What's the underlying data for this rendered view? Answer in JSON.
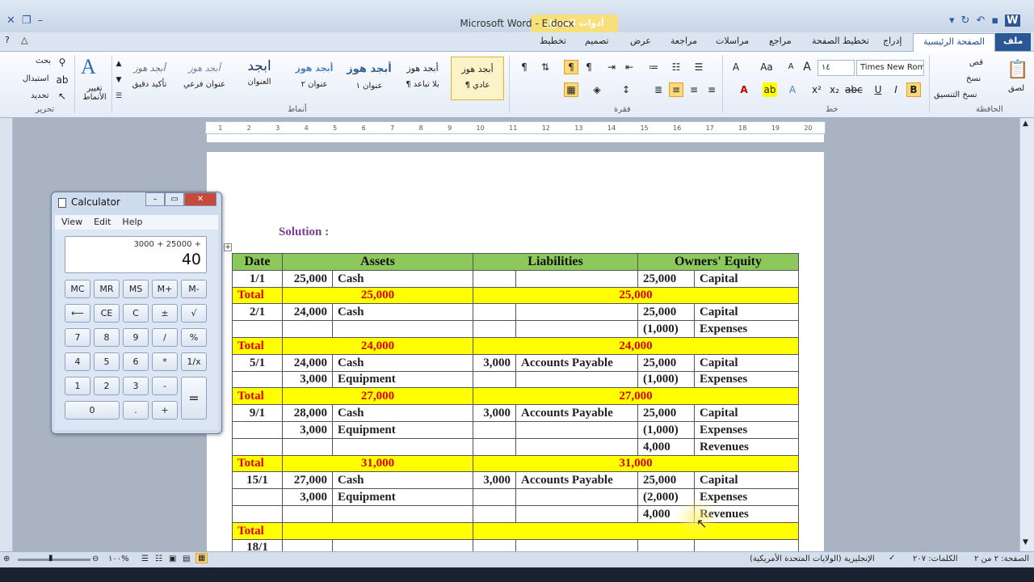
{
  "window": {
    "title": "Microsoft Word  -  E.docx",
    "context_tab": "أدوات الجدول"
  },
  "tabs": {
    "file": "ملف",
    "home": "الصفحة الرئيسية",
    "insert": "إدراج",
    "layout": "تخطيط الصفحة",
    "references": "مراجع",
    "mailings": "مراسلات",
    "review": "مراجعة",
    "view": "عرض",
    "design": "تصميم",
    "table_layout": "تخطيط"
  },
  "ribbon": {
    "clipboard": {
      "label": "الحافظة",
      "paste": "لصق",
      "cut": "قص",
      "copy": "نسخ",
      "format_painter": "نسخ التنسيق"
    },
    "font": {
      "label": "خط",
      "name": "Times New Roma",
      "size": "١٤"
    },
    "paragraph": {
      "label": "فقرة"
    },
    "styles": {
      "label": "أنماط",
      "items": [
        {
          "sample": "أبجد هوز",
          "name": "¶ عادي"
        },
        {
          "sample": "أبجد هوز",
          "name": "¶ بلا تباعد"
        },
        {
          "sample": "أبجد هوز",
          "name": "عنوان ١"
        },
        {
          "sample": "أبجد هوز",
          "name": "عنوان ٢"
        },
        {
          "sample": "ابجد",
          "name": "العنوان"
        },
        {
          "sample": "أبجد هوز",
          "name": "عنوان فرعي"
        },
        {
          "sample": "أبجد هوز",
          "name": "تأكيد دقيق"
        }
      ],
      "change_styles": "تغيير الأنماط"
    },
    "editing": {
      "label": "تحرير",
      "find": "بحث",
      "replace": "استبدال",
      "select": "تحديد"
    }
  },
  "ruler": {
    "ticks": [
      "1",
      "2",
      "3",
      "4",
      "5",
      "6",
      "7",
      "8",
      "9",
      "10",
      "11",
      "12",
      "13",
      "14",
      "15",
      "16",
      "17",
      "18",
      "19",
      "20"
    ]
  },
  "document": {
    "heading": "Solution :",
    "table": {
      "headers": {
        "date": "Date",
        "assets": "Assets",
        "liabilities": "Liabilities",
        "equity": "Owners'  Equity"
      },
      "r1": {
        "date": "1/1",
        "a_amt": "25,000",
        "a_name": "Cash",
        "e_amt": "25,000",
        "e_name": "Capital"
      },
      "t1": {
        "label": "Total",
        "assets": "25,000",
        "equity": "25,000"
      },
      "r2": {
        "date": "2/1",
        "a_amt": "24,000",
        "a_name": "Cash",
        "e_amt": "25,000",
        "e_name": "Capital"
      },
      "r3": {
        "e_amt": "(1,000)",
        "e_name": "Expenses"
      },
      "t2": {
        "label": "Total",
        "assets": "24,000",
        "equity": "24,000"
      },
      "r4": {
        "date": "5/1",
        "a_amt": "24,000",
        "a_name": "Cash",
        "l_amt": "3,000",
        "l_name": "Accounts Payable",
        "e_amt": "25,000",
        "e_name": "Capital"
      },
      "r5": {
        "a_amt": "3,000",
        "a_name": "Equipment",
        "e_amt": "(1,000)",
        "e_name": "Expenses"
      },
      "t3": {
        "label": "Total",
        "assets": "27,000",
        "equity": "27,000"
      },
      "r6": {
        "date": "9/1",
        "a_amt": "28,000",
        "a_name": "Cash",
        "l_amt": "3,000",
        "l_name": "Accounts Payable",
        "e_amt": "25,000",
        "e_name": "Capital"
      },
      "r7": {
        "a_amt": "3,000",
        "a_name": "Equipment",
        "e_amt": "(1,000)",
        "e_name": "Expenses"
      },
      "r8": {
        "e_amt": "4,000",
        "e_name": "Revenues"
      },
      "t4": {
        "label": "Total",
        "assets": "31,000",
        "equity": "31,000"
      },
      "r9": {
        "date": "15/1",
        "a_amt": "27,000",
        "a_name": "Cash",
        "l_amt": "3,000",
        "l_name": "Accounts Payable",
        "e_amt": "25,000",
        "e_name": "Capital"
      },
      "r10": {
        "a_amt": "3,000",
        "a_name": "Equipment",
        "e_amt": "(2,000)",
        "e_name": "Expenses"
      },
      "r11": {
        "e_amt": "4,000",
        "e_name": "Revenues"
      },
      "t5": {
        "label": "Total"
      },
      "r12": {
        "date": "18/1"
      }
    }
  },
  "calculator": {
    "title": "Calculator",
    "menu": {
      "view": "View",
      "edit": "Edit",
      "help": "Help"
    },
    "expression": "3000 + 25000 +",
    "display": "40",
    "buttons": {
      "mc": "MC",
      "mr": "MR",
      "ms": "MS",
      "mplus": "M+",
      "mminus": "M-",
      "back": "⟵",
      "ce": "CE",
      "c": "C",
      "pm": "±",
      "sqrt": "√",
      "n7": "7",
      "n8": "8",
      "n9": "9",
      "div": "/",
      "pct": "%",
      "n4": "4",
      "n5": "5",
      "n6": "6",
      "mul": "*",
      "inv": "1/x",
      "n1": "1",
      "n2": "2",
      "n3": "3",
      "sub": "-",
      "eq": "=",
      "n0": "0",
      "dot": ".",
      "add": "+"
    }
  },
  "status": {
    "page": "الصفحة: ٢ من ٢",
    "words": "الكلمات: ٢٠٧",
    "language": "الإنجليزية (الولايات المتحدة الأمريكية)",
    "zoom": "١٠٠%"
  }
}
